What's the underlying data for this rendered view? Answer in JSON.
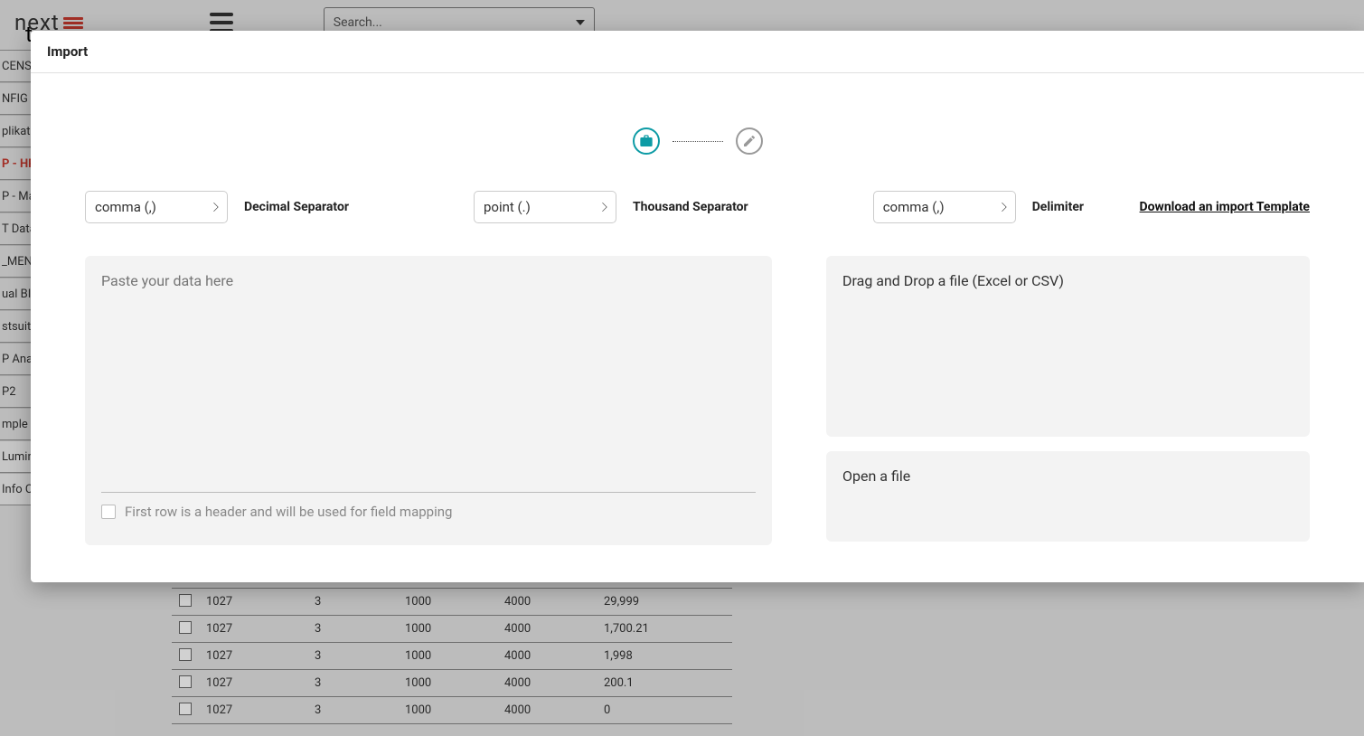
{
  "header": {
    "logo_brand": "next",
    "search_placeholder": "Search..."
  },
  "sidebar": {
    "items": [
      {
        "label": "CENSE_",
        "active": false
      },
      {
        "label": "NFIG",
        "active": false
      },
      {
        "label": "plikatio",
        "active": false
      },
      {
        "label": "P - HR",
        "active": true
      },
      {
        "label": "P - Ma",
        "active": false
      },
      {
        "label": "T Data",
        "active": false
      },
      {
        "label": "_MENU",
        "active": false
      },
      {
        "label": "ual BI",
        "active": false
      },
      {
        "label": "stsuite",
        "active": false
      },
      {
        "label": "P Anal",
        "active": false
      },
      {
        "label": "P2",
        "active": false
      },
      {
        "label": "mple D",
        "active": false
      },
      {
        "label": "Lumin",
        "active": false,
        "light": true
      },
      {
        "label": "Info C",
        "active": false,
        "light": true
      }
    ]
  },
  "modal": {
    "title": "Import",
    "decimal_sep_label": "Decimal Separator",
    "thousand_sep_label": "Thousand Separator",
    "delimiter_label": "Delimiter",
    "download_template": "Download an import Template",
    "select1_value": "comma (,)",
    "select2_value": "point (.)",
    "select3_value": "comma (,)",
    "paste_prompt": "Paste your data here",
    "header_row_label": "First row is a header and will be used for field mapping",
    "drop_label": "Drag and Drop a file (Excel or CSV)",
    "open_label": "Open a file"
  },
  "bg_table": {
    "rows": [
      {
        "c1": "1027",
        "c2": "3",
        "c3": "1000",
        "c4": "4000",
        "c5": "29,999"
      },
      {
        "c1": "1027",
        "c2": "3",
        "c3": "1000",
        "c4": "4000",
        "c5": "1,700.21"
      },
      {
        "c1": "1027",
        "c2": "3",
        "c3": "1000",
        "c4": "4000",
        "c5": "1,998"
      },
      {
        "c1": "1027",
        "c2": "3",
        "c3": "1000",
        "c4": "4000",
        "c5": "200.1"
      },
      {
        "c1": "1027",
        "c2": "3",
        "c3": "1000",
        "c4": "4000",
        "c5": "0"
      }
    ]
  }
}
